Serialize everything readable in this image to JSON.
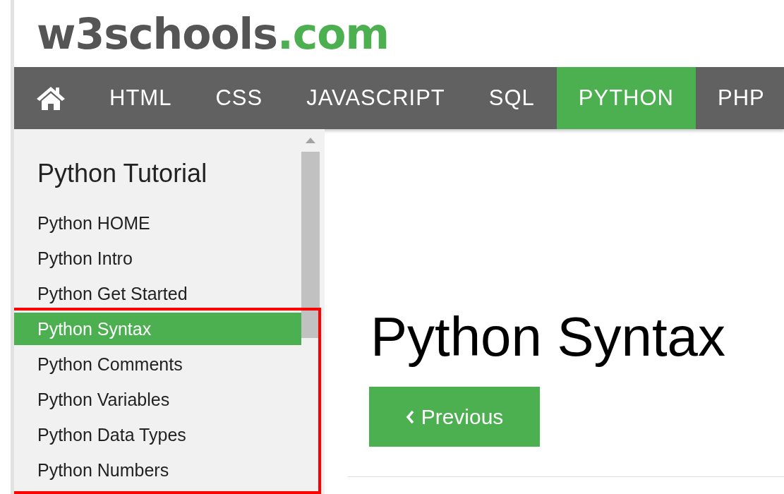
{
  "logo": {
    "name": "w3schools",
    "suffix": ".com"
  },
  "nav": [
    {
      "kind": "home",
      "selected": false
    },
    {
      "kind": "link",
      "label": "HTML",
      "selected": false
    },
    {
      "kind": "link",
      "label": "CSS",
      "selected": false
    },
    {
      "kind": "link",
      "label": "JAVASCRIPT",
      "selected": false
    },
    {
      "kind": "link",
      "label": "SQL",
      "selected": false
    },
    {
      "kind": "link",
      "label": "PYTHON",
      "selected": true
    },
    {
      "kind": "link",
      "label": "PHP",
      "selected": false
    }
  ],
  "sidebar": {
    "title": "Python Tutorial",
    "items": [
      {
        "label": "Python HOME",
        "selected": false
      },
      {
        "label": "Python Intro",
        "selected": false
      },
      {
        "label": "Python Get Started",
        "selected": false
      },
      {
        "label": "Python Syntax",
        "selected": true
      },
      {
        "label": "Python Comments",
        "selected": false
      },
      {
        "label": "Python Variables",
        "selected": false
      },
      {
        "label": "Python Data Types",
        "selected": false
      },
      {
        "label": "Python Numbers",
        "selected": false
      }
    ]
  },
  "main": {
    "heading": "Python Syntax",
    "previous_button": "Previous"
  }
}
